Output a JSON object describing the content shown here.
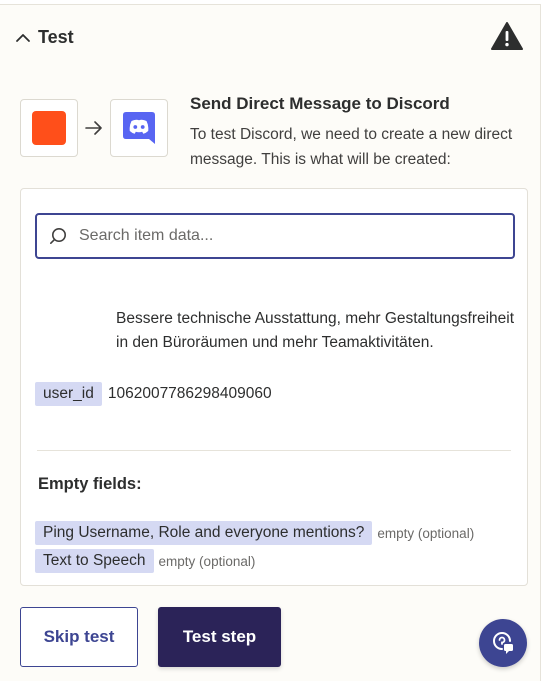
{
  "section": {
    "title": "Test"
  },
  "step": {
    "title": "Send Direct Message to Discord",
    "description": "To test Discord, we need to create a new direct message. This is what will be created:"
  },
  "search": {
    "placeholder": "Search item data..."
  },
  "data": {
    "message_value": "Bessere technische Ausstattung, mehr Gestaltungsfreiheit in den Büroräumen und mehr Teamaktivitäten.",
    "user_id_label": "user_id",
    "user_id_value": "1062007786298409060"
  },
  "empty_fields": {
    "title": "Empty fields:",
    "items": [
      {
        "label": "Ping Username, Role and everyone mentions?",
        "status": "empty (optional)"
      },
      {
        "label": "Text to Speech",
        "status": "empty (optional)"
      }
    ]
  },
  "buttons": {
    "skip": "Skip test",
    "test": "Test step"
  },
  "colors": {
    "accent": "#3d4592",
    "primary_button": "#2b2358",
    "tag_bg": "#d5d9f3",
    "app_orange": "#ff4f1a",
    "discord_blurple": "#5865f2"
  },
  "icons": {
    "collapse": "chevron-up-icon",
    "warning": "warning-triangle-icon",
    "arrow": "arrow-right-icon",
    "discord": "discord-logo-icon",
    "search": "search-icon",
    "help": "help-chat-icon"
  }
}
